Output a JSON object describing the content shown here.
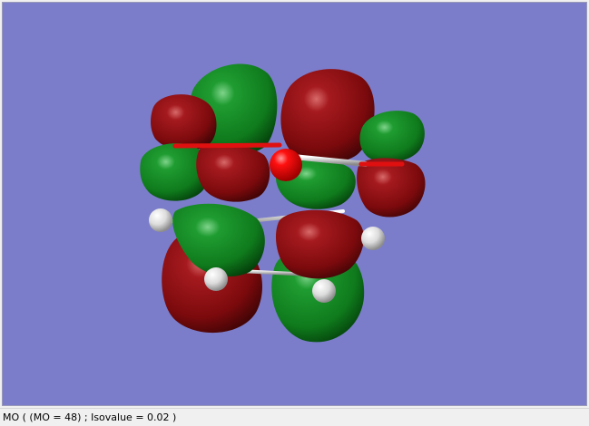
{
  "viewer": {
    "background_color": "#7b7dcb",
    "positive_lobe_color": "#8b0d10",
    "negative_lobe_color": "#107a1e",
    "oxygen_color": "#e50000",
    "hydrogen_color": "#e8e8e8"
  },
  "status": {
    "text": "MO ( (MO = 48) ; Isovalue = 0.02 )"
  }
}
